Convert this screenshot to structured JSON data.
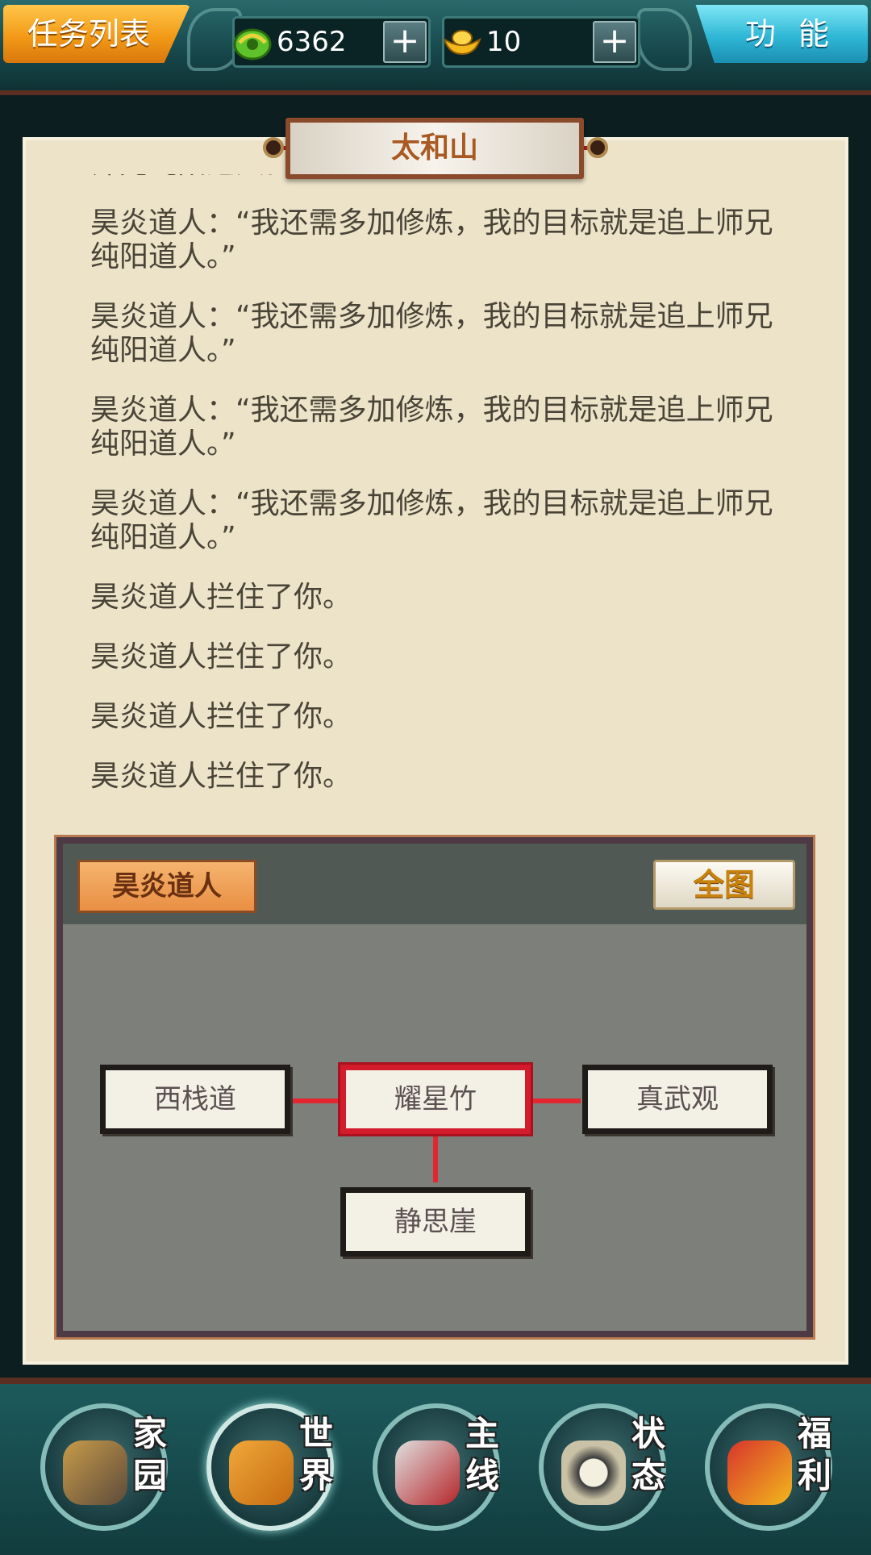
{
  "topbar": {
    "task_list_label": "任务列表",
    "function_label": "功能",
    "currency_jade": {
      "value": "6362",
      "plus": "+"
    },
    "currency_gold": {
      "value": "10",
      "plus": "+"
    }
  },
  "location": {
    "title": "太和山"
  },
  "story": {
    "lines": [
      "师兄纯阳道人。”",
      "昊炎道人：“我还需多加修炼，我的目标就是追上师兄纯阳道人。”",
      "昊炎道人：“我还需多加修炼，我的目标就是追上师兄纯阳道人。”",
      "昊炎道人：“我还需多加修炼，我的目标就是追上师兄纯阳道人。”",
      "昊炎道人：“我还需多加修炼，我的目标就是追上师兄纯阳道人。”",
      "昊炎道人拦住了你。",
      "昊炎道人拦住了你。",
      "昊炎道人拦住了你。",
      "昊炎道人拦住了你。"
    ]
  },
  "map": {
    "npc_label": "昊炎道人",
    "full_map_label": "全图",
    "nodes": {
      "west": "西栈道",
      "center": "耀星竹",
      "east": "真武观",
      "south": "静思崖"
    }
  },
  "bottom_nav": {
    "home": "家\n园",
    "world": "世\n界",
    "main_quest": "主\n线",
    "status": "状\n态",
    "welfare": "福\n利"
  },
  "colors": {
    "active_route": "#e3262f",
    "task_button": "#f29a17",
    "function_button": "#2fb7d6",
    "paper": "#ece3c9"
  }
}
